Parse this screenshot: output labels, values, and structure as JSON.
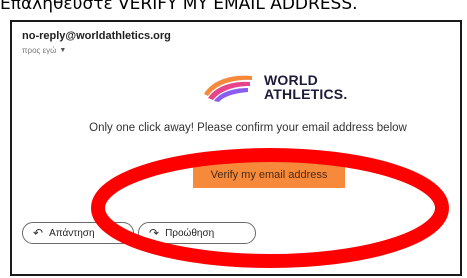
{
  "caption": "Επαληθεύστε VERIFY MY EMAIL ADDRESS.",
  "email": {
    "sender": "no-reply@worldathletics.org",
    "recipient": "προς εγώ",
    "logo_line1": "WORLD",
    "logo_line2": "ATHLETICS.",
    "headline": "Only one click away! Please confirm your email address below",
    "verify_button": "Verify my email address"
  },
  "actions": {
    "reply_label": "Απάντηση",
    "forward_label": "Προώθηση"
  },
  "colors": {
    "verify_button_bg": "#f7893b",
    "annotation_red": "#ff0000"
  },
  "icons": [
    "chevron-down-icon",
    "reply-icon",
    "forward-icon",
    "world-athletics-logo"
  ]
}
